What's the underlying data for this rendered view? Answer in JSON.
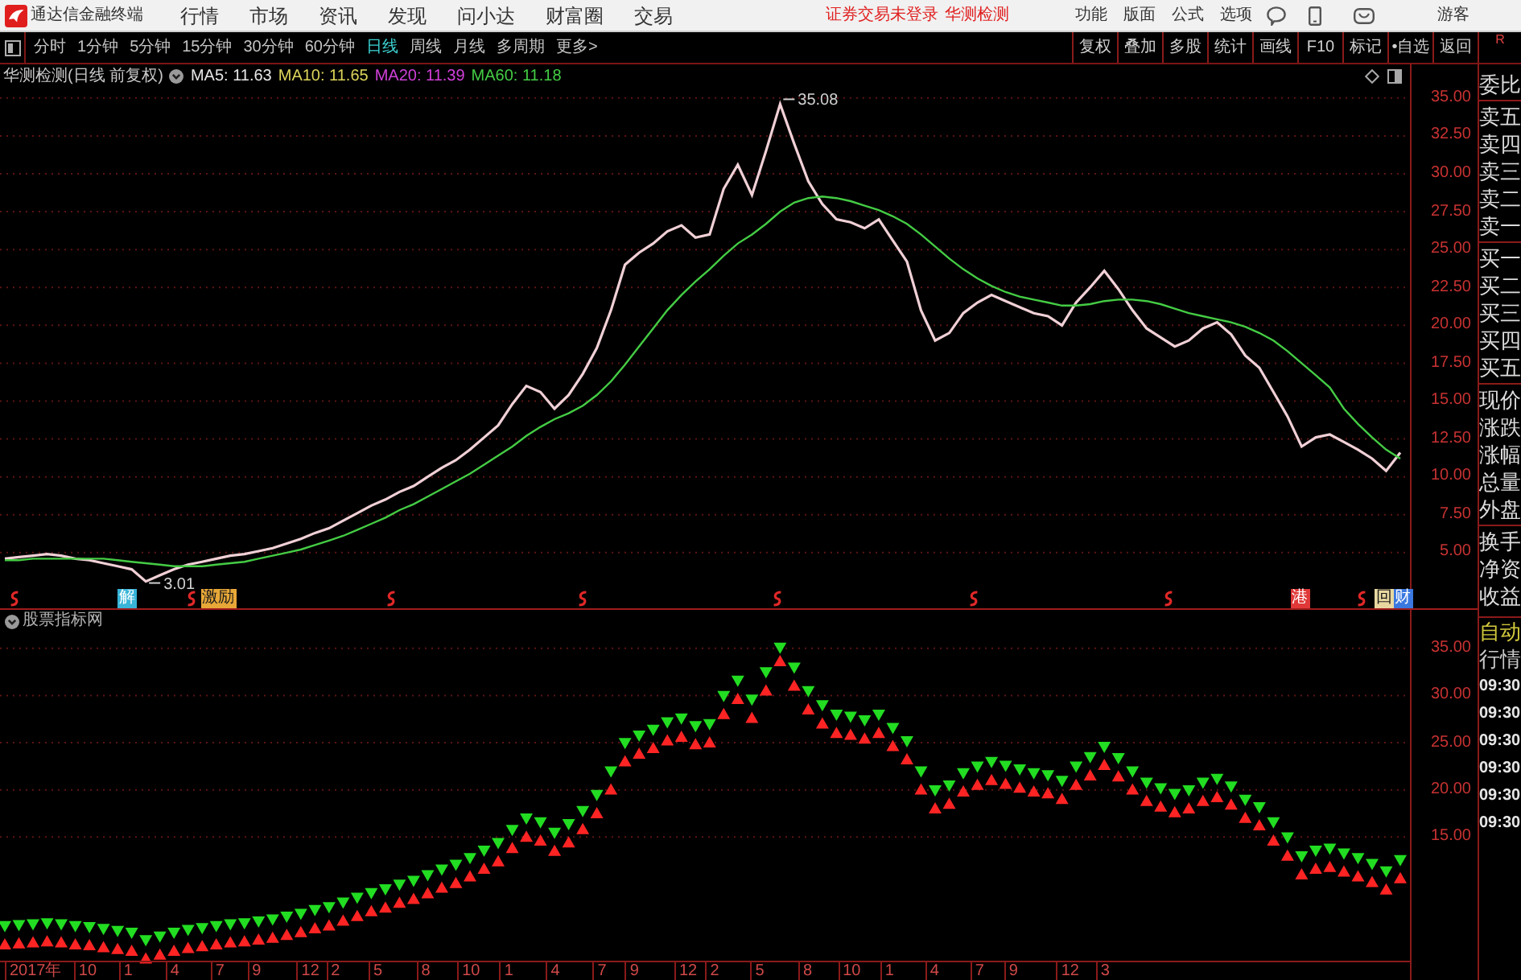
{
  "menu_bar": {
    "app_name": "通达信金融终端",
    "menus": [
      "行情",
      "市场",
      "资讯",
      "发现",
      "问小达",
      "财富圈",
      "交易"
    ],
    "notices": [
      "证券交易未登录",
      "华测检测"
    ],
    "tools": [
      "功能",
      "版面",
      "公式",
      "选项"
    ],
    "user": "游客"
  },
  "period_bar": {
    "periods": [
      {
        "label": "分时",
        "selected": false
      },
      {
        "label": "1分钟",
        "selected": false
      },
      {
        "label": "5分钟",
        "selected": false
      },
      {
        "label": "15分钟",
        "selected": false
      },
      {
        "label": "30分钟",
        "selected": false
      },
      {
        "label": "60分钟",
        "selected": false
      },
      {
        "label": "日线",
        "selected": true
      },
      {
        "label": "周线",
        "selected": false
      },
      {
        "label": "月线",
        "selected": false
      },
      {
        "label": "多周期",
        "selected": false
      },
      {
        "label": "更多>",
        "selected": false
      }
    ],
    "buttons": [
      "复权",
      "叠加",
      "多股",
      "统计",
      "画线",
      "F10",
      "标记",
      "•自选",
      "返回"
    ],
    "corner_label": "R"
  },
  "main_chart": {
    "legend": [
      {
        "label": "MA5: 11.63",
        "color": "#e6e6e6"
      },
      {
        "label": "MA10: 11.65",
        "color": "#dcd45a"
      },
      {
        "label": "MA20: 11.39",
        "color": "#d040d8"
      },
      {
        "label": "MA60: 11.18",
        "color": "#44cc44"
      }
    ],
    "chart_data": {
      "type": "line",
      "title": "华测检测(日线 前复权)",
      "grid": true,
      "ylim": [
        2.6,
        35.63
      ],
      "yticks": [
        {
          "value": 35,
          "label": "35.00"
        },
        {
          "value": 32.5,
          "label": "32.50"
        },
        {
          "value": 30,
          "label": "30.00"
        },
        {
          "value": 27.5,
          "label": "27.50"
        },
        {
          "value": 25,
          "label": "25.00"
        },
        {
          "value": 22.5,
          "label": "22.50"
        },
        {
          "value": 20,
          "label": "20.00"
        },
        {
          "value": 17.5,
          "label": "17.50"
        },
        {
          "value": 15,
          "label": "15.00"
        },
        {
          "value": 12.5,
          "label": "12.50"
        },
        {
          "value": 10,
          "label": "10.00"
        },
        {
          "value": 7.5,
          "label": "7.50"
        },
        {
          "value": 5,
          "label": "5.00"
        }
      ],
      "series": [
        {
          "color": "#f0d0d6",
          "values": [
            4.6,
            4.7,
            4.8,
            4.9,
            4.8,
            4.6,
            4.5,
            4.3,
            4.1,
            3.9,
            3.1,
            3.5,
            3.9,
            4.2,
            4.4,
            4.6,
            4.8,
            4.9,
            5.1,
            5.3,
            5.6,
            5.9,
            6.3,
            6.6,
            7.1,
            7.6,
            8.1,
            8.5,
            9.0,
            9.4,
            10.0,
            10.6,
            11.1,
            11.8,
            12.6,
            13.4,
            14.8,
            16.0,
            15.6,
            14.5,
            15.4,
            16.8,
            18.5,
            21.0,
            24.0,
            24.8,
            25.4,
            26.2,
            26.6,
            25.8,
            26.0,
            29.0,
            30.6,
            28.6,
            31.5,
            34.6,
            32.0,
            29.5,
            28.0,
            27.0,
            26.8,
            26.4,
            27.0,
            25.6,
            24.2,
            21.0,
            19.0,
            19.5,
            20.8,
            21.5,
            22.0,
            21.6,
            21.2,
            20.8,
            20.6,
            20.0,
            21.5,
            22.5,
            23.6,
            22.4,
            21.0,
            19.8,
            19.2,
            18.6,
            19.0,
            19.8,
            20.2,
            19.4,
            18.0,
            17.2,
            15.6,
            14.0,
            12.0,
            12.6,
            12.8,
            12.3,
            11.8,
            11.2,
            10.4,
            11.6
          ]
        },
        {
          "color": "#44cc44",
          "values": [
            4.5,
            4.5,
            4.6,
            4.6,
            4.6,
            4.6,
            4.6,
            4.6,
            4.5,
            4.4,
            4.3,
            4.2,
            4.1,
            4.1,
            4.1,
            4.2,
            4.3,
            4.4,
            4.6,
            4.8,
            5.0,
            5.2,
            5.5,
            5.8,
            6.1,
            6.5,
            6.9,
            7.3,
            7.8,
            8.2,
            8.7,
            9.2,
            9.7,
            10.2,
            10.8,
            11.4,
            12.0,
            12.7,
            13.3,
            13.8,
            14.2,
            14.7,
            15.4,
            16.3,
            17.4,
            18.6,
            19.8,
            21.0,
            22.0,
            22.9,
            23.7,
            24.6,
            25.4,
            26.0,
            26.7,
            27.5,
            28.1,
            28.4,
            28.5,
            28.4,
            28.2,
            27.9,
            27.6,
            27.2,
            26.7,
            26.0,
            25.2,
            24.4,
            23.7,
            23.1,
            22.6,
            22.2,
            21.9,
            21.7,
            21.5,
            21.3,
            21.3,
            21.4,
            21.6,
            21.7,
            21.7,
            21.6,
            21.4,
            21.1,
            20.8,
            20.6,
            20.4,
            20.2,
            19.9,
            19.5,
            19.0,
            18.3,
            17.5,
            16.7,
            15.9,
            14.5,
            13.5,
            12.6,
            11.8,
            11.2
          ]
        }
      ],
      "annotations": [
        "35.08",
        "3.01"
      ]
    },
    "events": [
      {
        "kind": "mark"
      },
      {
        "kind": "tag",
        "label": "解",
        "color": "#38b4d8"
      },
      {
        "kind": "mark"
      },
      {
        "kind": "tag",
        "label": "激励",
        "color": "#e8a838"
      },
      {
        "kind": "mark"
      },
      {
        "kind": "mark"
      },
      {
        "kind": "mark"
      },
      {
        "kind": "mark"
      },
      {
        "kind": "mark"
      },
      {
        "kind": "tag",
        "label": "港",
        "color": "#e03838"
      },
      {
        "kind": "mark"
      },
      {
        "kind": "tag",
        "label": "回",
        "color": "#e8d8a0"
      },
      {
        "kind": "tag",
        "label": "财",
        "color": "#3a78e0"
      }
    ]
  },
  "indicator_chart": {
    "chart_data": {
      "type": "scatter",
      "title": "股票指标网",
      "grid": true,
      "ylim": [
        1.9,
        36.69
      ],
      "yticks": [
        {
          "value": 35,
          "label": "35.00"
        },
        {
          "value": 30,
          "label": "30.00"
        },
        {
          "value": 25,
          "label": "25.00"
        },
        {
          "value": 20,
          "label": "20.00"
        },
        {
          "value": 15,
          "label": "15.00"
        }
      ],
      "series": [
        {
          "color": "#22dd22",
          "values": [
            5.5,
            5.6,
            5.7,
            5.8,
            5.7,
            5.5,
            5.4,
            5.2,
            5.0,
            4.8,
            4.0,
            4.4,
            4.8,
            5.1,
            5.3,
            5.5,
            5.7,
            5.8,
            6.0,
            6.2,
            6.5,
            6.8,
            7.2,
            7.5,
            8.0,
            8.5,
            9.0,
            9.4,
            9.9,
            10.3,
            10.9,
            11.5,
            12.0,
            12.7,
            13.5,
            14.3,
            15.7,
            16.9,
            16.5,
            15.4,
            16.3,
            17.7,
            19.4,
            21.9,
            24.9,
            25.7,
            26.3,
            27.1,
            27.5,
            26.7,
            26.9,
            29.9,
            31.5,
            29.5,
            32.4,
            35.0,
            32.9,
            30.4,
            28.9,
            27.9,
            27.7,
            27.3,
            27.9,
            26.5,
            25.1,
            21.9,
            19.9,
            20.4,
            21.7,
            22.4,
            22.9,
            22.5,
            22.1,
            21.7,
            21.5,
            20.9,
            22.4,
            23.4,
            24.5,
            23.3,
            21.9,
            20.7,
            20.1,
            19.5,
            19.9,
            20.7,
            21.1,
            20.3,
            18.9,
            18.1,
            16.5,
            14.9,
            12.9,
            13.5,
            13.7,
            13.2,
            12.7,
            12.1,
            11.3,
            12.5
          ]
        },
        {
          "color": "#ff2424",
          "values": [
            3.7,
            3.8,
            3.9,
            4.0,
            3.9,
            3.7,
            3.6,
            3.4,
            3.2,
            3.0,
            2.2,
            2.6,
            3.0,
            3.3,
            3.5,
            3.7,
            3.9,
            4.0,
            4.2,
            4.4,
            4.7,
            5.0,
            5.4,
            5.7,
            6.2,
            6.7,
            7.2,
            7.6,
            8.1,
            8.5,
            9.1,
            9.7,
            10.2,
            10.9,
            11.7,
            12.5,
            13.9,
            15.1,
            14.7,
            13.6,
            14.5,
            15.9,
            17.6,
            20.1,
            23.1,
            23.9,
            24.5,
            25.3,
            25.7,
            24.9,
            25.1,
            28.1,
            29.7,
            27.7,
            30.6,
            33.7,
            31.1,
            28.6,
            27.1,
            26.1,
            25.9,
            25.5,
            26.1,
            24.7,
            23.3,
            20.1,
            18.1,
            18.6,
            19.9,
            20.6,
            21.1,
            20.7,
            20.3,
            19.9,
            19.7,
            19.1,
            20.6,
            21.6,
            22.7,
            21.5,
            20.1,
            18.9,
            18.3,
            17.7,
            18.1,
            18.9,
            19.3,
            18.5,
            17.1,
            16.3,
            14.7,
            13.1,
            11.1,
            11.7,
            11.9,
            11.4,
            10.9,
            10.3,
            9.5,
            10.7
          ]
        }
      ]
    },
    "date_labels": [
      "2017年",
      "10",
      "1",
      "4",
      "7",
      "9",
      "12",
      "2",
      "5",
      "8",
      "10",
      "1",
      "4",
      "7",
      "9",
      "12",
      "2",
      "5",
      "8",
      "10",
      "1",
      "4",
      "7",
      "9",
      "12",
      "3"
    ]
  },
  "quote_panel": {
    "groups": [
      [
        "委比"
      ],
      [
        "卖五",
        "卖四",
        "卖三",
        "卖二",
        "卖一"
      ],
      [
        "买一",
        "买二",
        "买三",
        "买四",
        "买五"
      ],
      [
        "现价",
        "涨跌",
        "涨幅",
        "总量",
        "外盘"
      ],
      [
        "换手",
        "净资",
        "收益"
      ]
    ],
    "modes": [
      {
        "label": "自动",
        "selected": true
      },
      {
        "label": "行情",
        "selected": false
      }
    ],
    "times": [
      "09:30",
      "09:30",
      "09:30",
      "09:30",
      "09:30",
      "09:30"
    ]
  }
}
